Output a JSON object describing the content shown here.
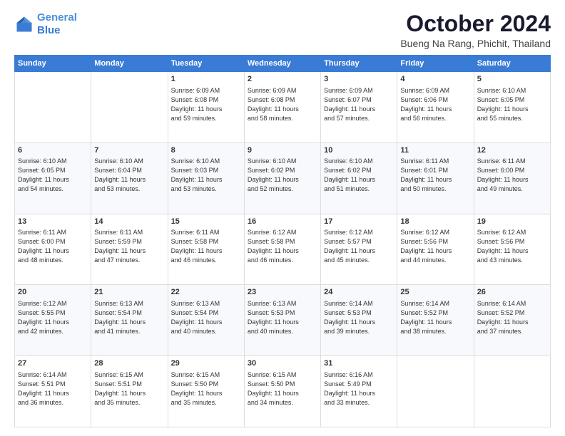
{
  "logo": {
    "line1": "General",
    "line2": "Blue"
  },
  "title": "October 2024",
  "subtitle": "Bueng Na Rang, Phichit, Thailand",
  "days_of_week": [
    "Sunday",
    "Monday",
    "Tuesday",
    "Wednesday",
    "Thursday",
    "Friday",
    "Saturday"
  ],
  "weeks": [
    [
      {
        "day": "",
        "sunrise": "",
        "sunset": "",
        "daylight": ""
      },
      {
        "day": "",
        "sunrise": "",
        "sunset": "",
        "daylight": ""
      },
      {
        "day": "1",
        "sunrise": "Sunrise: 6:09 AM",
        "sunset": "Sunset: 6:08 PM",
        "daylight": "Daylight: 11 hours and 59 minutes."
      },
      {
        "day": "2",
        "sunrise": "Sunrise: 6:09 AM",
        "sunset": "Sunset: 6:08 PM",
        "daylight": "Daylight: 11 hours and 58 minutes."
      },
      {
        "day": "3",
        "sunrise": "Sunrise: 6:09 AM",
        "sunset": "Sunset: 6:07 PM",
        "daylight": "Daylight: 11 hours and 57 minutes."
      },
      {
        "day": "4",
        "sunrise": "Sunrise: 6:09 AM",
        "sunset": "Sunset: 6:06 PM",
        "daylight": "Daylight: 11 hours and 56 minutes."
      },
      {
        "day": "5",
        "sunrise": "Sunrise: 6:10 AM",
        "sunset": "Sunset: 6:05 PM",
        "daylight": "Daylight: 11 hours and 55 minutes."
      }
    ],
    [
      {
        "day": "6",
        "sunrise": "Sunrise: 6:10 AM",
        "sunset": "Sunset: 6:05 PM",
        "daylight": "Daylight: 11 hours and 54 minutes."
      },
      {
        "day": "7",
        "sunrise": "Sunrise: 6:10 AM",
        "sunset": "Sunset: 6:04 PM",
        "daylight": "Daylight: 11 hours and 53 minutes."
      },
      {
        "day": "8",
        "sunrise": "Sunrise: 6:10 AM",
        "sunset": "Sunset: 6:03 PM",
        "daylight": "Daylight: 11 hours and 53 minutes."
      },
      {
        "day": "9",
        "sunrise": "Sunrise: 6:10 AM",
        "sunset": "Sunset: 6:02 PM",
        "daylight": "Daylight: 11 hours and 52 minutes."
      },
      {
        "day": "10",
        "sunrise": "Sunrise: 6:10 AM",
        "sunset": "Sunset: 6:02 PM",
        "daylight": "Daylight: 11 hours and 51 minutes."
      },
      {
        "day": "11",
        "sunrise": "Sunrise: 6:11 AM",
        "sunset": "Sunset: 6:01 PM",
        "daylight": "Daylight: 11 hours and 50 minutes."
      },
      {
        "day": "12",
        "sunrise": "Sunrise: 6:11 AM",
        "sunset": "Sunset: 6:00 PM",
        "daylight": "Daylight: 11 hours and 49 minutes."
      }
    ],
    [
      {
        "day": "13",
        "sunrise": "Sunrise: 6:11 AM",
        "sunset": "Sunset: 6:00 PM",
        "daylight": "Daylight: 11 hours and 48 minutes."
      },
      {
        "day": "14",
        "sunrise": "Sunrise: 6:11 AM",
        "sunset": "Sunset: 5:59 PM",
        "daylight": "Daylight: 11 hours and 47 minutes."
      },
      {
        "day": "15",
        "sunrise": "Sunrise: 6:11 AM",
        "sunset": "Sunset: 5:58 PM",
        "daylight": "Daylight: 11 hours and 46 minutes."
      },
      {
        "day": "16",
        "sunrise": "Sunrise: 6:12 AM",
        "sunset": "Sunset: 5:58 PM",
        "daylight": "Daylight: 11 hours and 46 minutes."
      },
      {
        "day": "17",
        "sunrise": "Sunrise: 6:12 AM",
        "sunset": "Sunset: 5:57 PM",
        "daylight": "Daylight: 11 hours and 45 minutes."
      },
      {
        "day": "18",
        "sunrise": "Sunrise: 6:12 AM",
        "sunset": "Sunset: 5:56 PM",
        "daylight": "Daylight: 11 hours and 44 minutes."
      },
      {
        "day": "19",
        "sunrise": "Sunrise: 6:12 AM",
        "sunset": "Sunset: 5:56 PM",
        "daylight": "Daylight: 11 hours and 43 minutes."
      }
    ],
    [
      {
        "day": "20",
        "sunrise": "Sunrise: 6:12 AM",
        "sunset": "Sunset: 5:55 PM",
        "daylight": "Daylight: 11 hours and 42 minutes."
      },
      {
        "day": "21",
        "sunrise": "Sunrise: 6:13 AM",
        "sunset": "Sunset: 5:54 PM",
        "daylight": "Daylight: 11 hours and 41 minutes."
      },
      {
        "day": "22",
        "sunrise": "Sunrise: 6:13 AM",
        "sunset": "Sunset: 5:54 PM",
        "daylight": "Daylight: 11 hours and 40 minutes."
      },
      {
        "day": "23",
        "sunrise": "Sunrise: 6:13 AM",
        "sunset": "Sunset: 5:53 PM",
        "daylight": "Daylight: 11 hours and 40 minutes."
      },
      {
        "day": "24",
        "sunrise": "Sunrise: 6:14 AM",
        "sunset": "Sunset: 5:53 PM",
        "daylight": "Daylight: 11 hours and 39 minutes."
      },
      {
        "day": "25",
        "sunrise": "Sunrise: 6:14 AM",
        "sunset": "Sunset: 5:52 PM",
        "daylight": "Daylight: 11 hours and 38 minutes."
      },
      {
        "day": "26",
        "sunrise": "Sunrise: 6:14 AM",
        "sunset": "Sunset: 5:52 PM",
        "daylight": "Daylight: 11 hours and 37 minutes."
      }
    ],
    [
      {
        "day": "27",
        "sunrise": "Sunrise: 6:14 AM",
        "sunset": "Sunset: 5:51 PM",
        "daylight": "Daylight: 11 hours and 36 minutes."
      },
      {
        "day": "28",
        "sunrise": "Sunrise: 6:15 AM",
        "sunset": "Sunset: 5:51 PM",
        "daylight": "Daylight: 11 hours and 35 minutes."
      },
      {
        "day": "29",
        "sunrise": "Sunrise: 6:15 AM",
        "sunset": "Sunset: 5:50 PM",
        "daylight": "Daylight: 11 hours and 35 minutes."
      },
      {
        "day": "30",
        "sunrise": "Sunrise: 6:15 AM",
        "sunset": "Sunset: 5:50 PM",
        "daylight": "Daylight: 11 hours and 34 minutes."
      },
      {
        "day": "31",
        "sunrise": "Sunrise: 6:16 AM",
        "sunset": "Sunset: 5:49 PM",
        "daylight": "Daylight: 11 hours and 33 minutes."
      },
      {
        "day": "",
        "sunrise": "",
        "sunset": "",
        "daylight": ""
      },
      {
        "day": "",
        "sunrise": "",
        "sunset": "",
        "daylight": ""
      }
    ]
  ]
}
